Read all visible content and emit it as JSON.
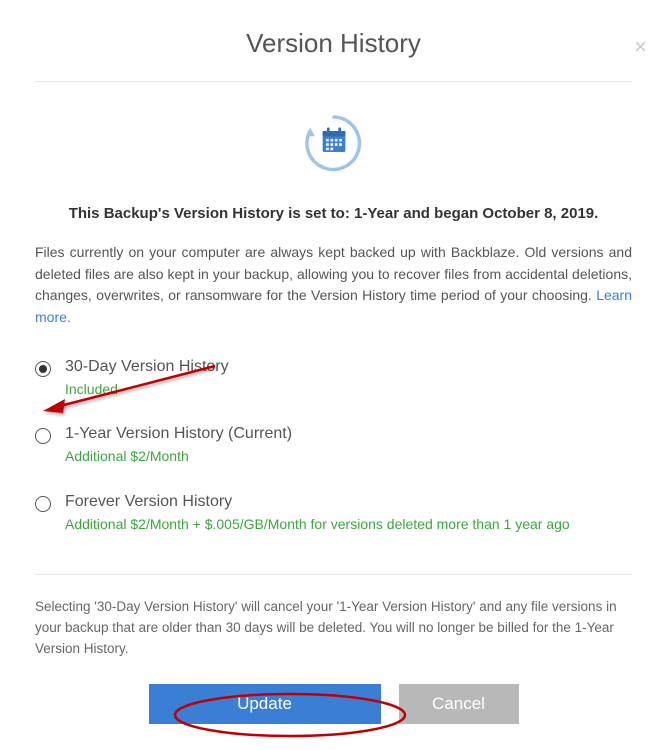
{
  "modal": {
    "close_glyph": "×",
    "title": "Version History",
    "icon_name": "calendar-history-icon",
    "status_prefix": "This Backup's Version History is set to: ",
    "status_plan": "1-Year",
    "status_middle": " and began ",
    "status_date": "October 8, 2019",
    "status_suffix": ".",
    "description": "Files currently on your computer are always kept backed up with Backblaze. Old versions and deleted files are also kept in your backup, allowing you to recover files from accidental deletions, changes, overwrites, or ransomware for the Version History time period of your choosing. ",
    "learn_more": "Learn more.",
    "options": [
      {
        "label": "30-Day Version History",
        "sub": "Included",
        "selected": true
      },
      {
        "label": "1-Year Version History (Current)",
        "sub": "Additional $2/Month",
        "selected": false
      },
      {
        "label": "Forever Version History",
        "sub": "Additional $2/Month + $.005/GB/Month for versions deleted more than 1 year ago",
        "selected": false
      }
    ],
    "footer_note": "Selecting '30-Day Version History' will cancel your '1-Year Version History' and any file versions in your backup that are older than 30 days will be deleted. You will no longer be billed for the 1-Year Version History.",
    "update_label": "Update",
    "cancel_label": "Cancel"
  },
  "colors": {
    "accent": "#3a7fd5",
    "green": "#3da63d",
    "annotation": "#c00000"
  }
}
